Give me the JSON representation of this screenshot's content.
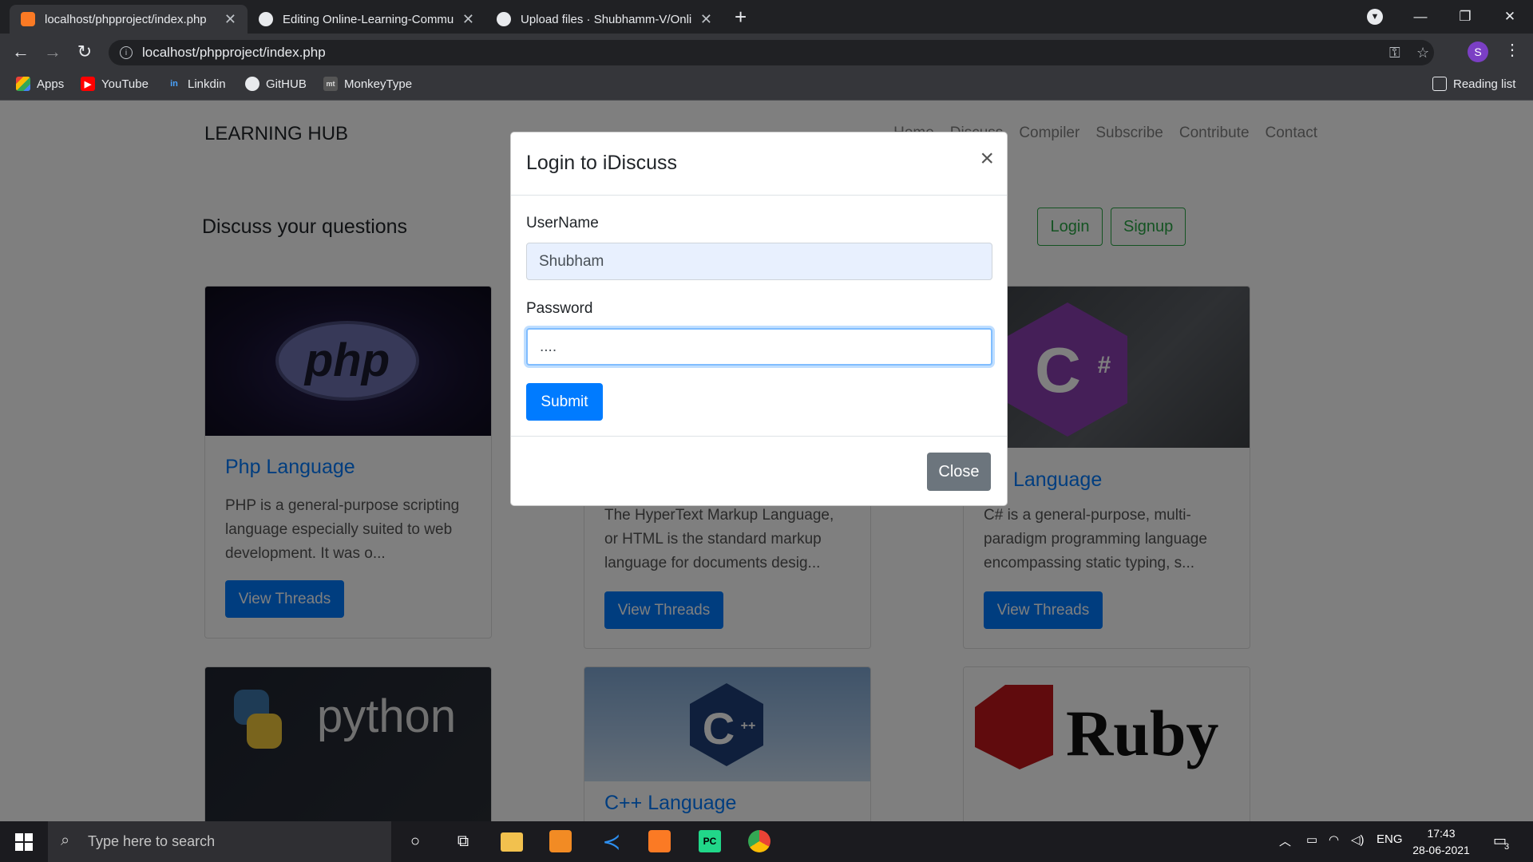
{
  "browser": {
    "tabs": [
      {
        "title": "localhost/phpproject/index.php",
        "icon": "xampp-icon"
      },
      {
        "title": "Editing Online-Learning-Commu",
        "icon": "github-icon"
      },
      {
        "title": "Upload files · Shubhamm-V/Onlin",
        "icon": "github-icon"
      }
    ],
    "url": "localhost/phpproject/index.php",
    "profile_initial": "S",
    "bookmarks": [
      "Apps",
      "YouTube",
      "Linkdin",
      "GitHUB",
      "MonkeyType"
    ],
    "reading_list": "Reading list"
  },
  "site": {
    "brand": "LEARNING HUB",
    "nav": [
      "Home",
      "Discuss",
      "Compiler",
      "Subscribe",
      "Contribute",
      "Contact"
    ],
    "heading": "Discuss your questions",
    "login_label": "Login",
    "signup_label": "Signup",
    "view_threads_label": "View Threads",
    "cards": [
      {
        "title": "Php Language",
        "text": [
          "PHP is a general-purpose scripting",
          "language especially suited to web",
          "development. It was o..."
        ]
      },
      {
        "title": "",
        "text": [
          "The HyperText Markup Language,",
          "or HTML is the standard markup",
          "language for documents desig..."
        ]
      },
      {
        "title": "Language",
        "text": [
          "C# is a general-purpose, multi-",
          "paradigm programming language",
          "encompassing static typing, s..."
        ]
      },
      {
        "title": "",
        "image_text": "python"
      },
      {
        "title": "C++ Language"
      },
      {
        "title": "",
        "image_text": "Ruby"
      }
    ]
  },
  "modal": {
    "title": "Login to iDiscuss",
    "username_label": "UserName",
    "username_value": "Shubham",
    "password_label": "Password",
    "password_value": "....",
    "submit_label": "Submit",
    "close_label": "Close"
  },
  "taskbar": {
    "search_placeholder": "Type here to search",
    "language": "ENG",
    "time": "17:43",
    "date": "28-06-2021",
    "notifications": "3"
  }
}
